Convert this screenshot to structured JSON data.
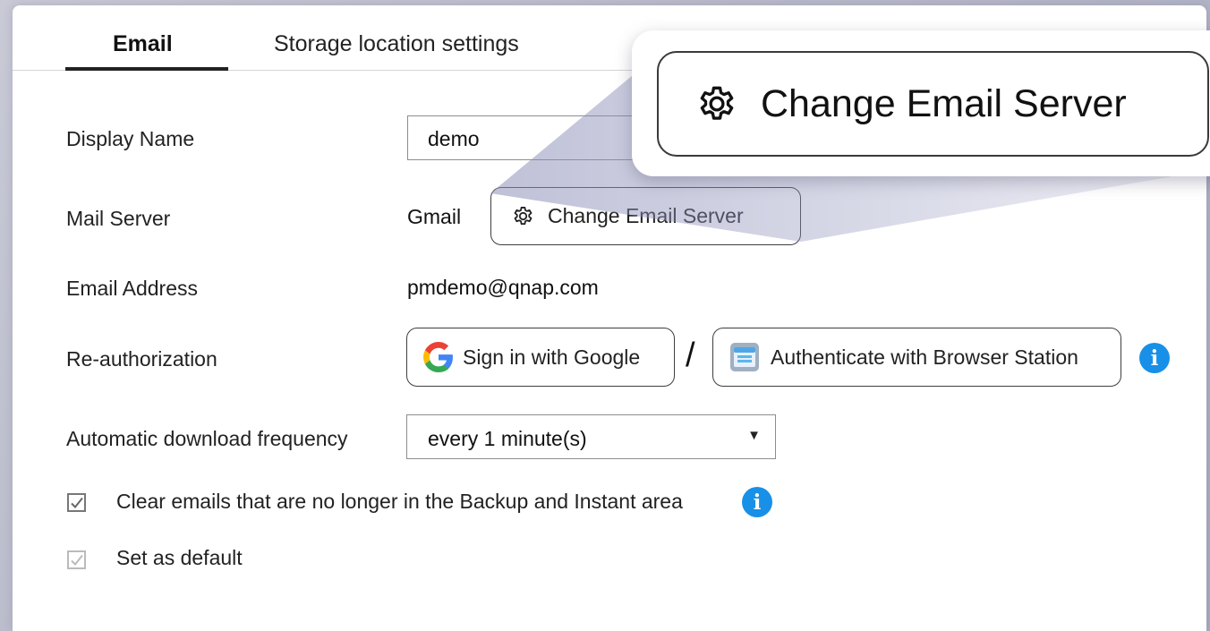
{
  "tabs": [
    {
      "label": "Email",
      "active": true
    },
    {
      "label": "Storage location settings",
      "active": false
    }
  ],
  "form": {
    "display_name": {
      "label": "Display Name",
      "value": "demo"
    },
    "mail_server": {
      "label": "Mail Server",
      "value": "Gmail",
      "button": "Change Email Server"
    },
    "email_address": {
      "label": "Email Address",
      "value": "pmdemo@qnap.com"
    },
    "reauthorization": {
      "label": "Re-authorization",
      "google_button": "Sign in with Google",
      "separator": "/",
      "browser_button": "Authenticate with Browser Station"
    },
    "download_frequency": {
      "label": "Automatic download frequency",
      "selected": "every 1 minute(s)"
    },
    "clear_emails": {
      "label": "Clear emails that are no longer in the Backup and Instant area",
      "checked": true
    },
    "set_default": {
      "label": "Set as default",
      "checked": true,
      "disabled": true
    }
  },
  "callout": {
    "label": "Change Email Server"
  },
  "icons": {
    "gear": "gear-icon",
    "google": "google-icon",
    "browser_station": "browser-station-icon",
    "info": "info-icon",
    "dropdown": "caret-down-icon",
    "check": "checkmark-icon"
  },
  "colors": {
    "info_blue": "#1890e8",
    "border": "#3e3e3e",
    "tab_underline": "#222222"
  }
}
